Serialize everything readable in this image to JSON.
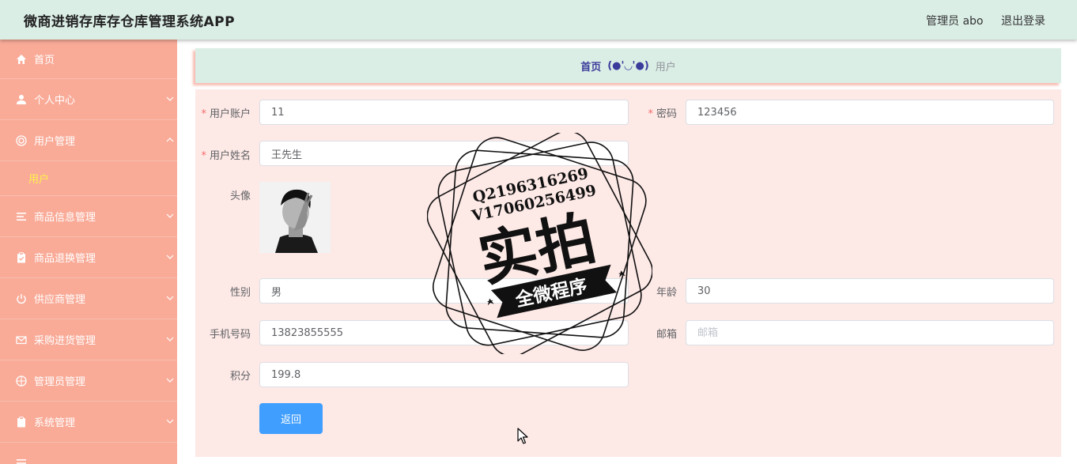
{
  "header": {
    "title": "微商进销存库存仓库管理系统APP",
    "user": "管理员 abo",
    "logout": "退出登录"
  },
  "sidebar": {
    "items": [
      {
        "label": "首页",
        "icon": "home-icon"
      },
      {
        "label": "个人中心",
        "icon": "user-icon"
      },
      {
        "label": "用户管理",
        "icon": "target-icon",
        "expanded": true,
        "children": [
          {
            "label": "用户"
          }
        ]
      },
      {
        "label": "商品信息管理",
        "icon": "list-icon"
      },
      {
        "label": "商品退换管理",
        "icon": "clipboard-icon"
      },
      {
        "label": "供应商管理",
        "icon": "power-icon"
      },
      {
        "label": "采购进货管理",
        "icon": "mail-icon"
      },
      {
        "label": "管理员管理",
        "icon": "compass-icon"
      },
      {
        "label": "系统管理",
        "icon": "clipboard-icon"
      }
    ],
    "active_color": "#fff24a"
  },
  "breadcrumb": {
    "home": "首页",
    "separator": "(●'◡'●)",
    "current": "用户"
  },
  "form": {
    "account": {
      "label": "用户账户",
      "value": "11"
    },
    "password": {
      "label": "密码",
      "value": "123456"
    },
    "name": {
      "label": "用户姓名",
      "value": "王先生"
    },
    "avatar": {
      "label": "头像"
    },
    "gender": {
      "label": "性别",
      "value": "男"
    },
    "age": {
      "label": "年龄",
      "value": "30"
    },
    "phone": {
      "label": "手机号码",
      "value": "13823855555"
    },
    "email": {
      "label": "邮箱",
      "value": "",
      "placeholder": "邮箱"
    },
    "points": {
      "label": "积分",
      "value": "199.8"
    },
    "back_label": "返回",
    "required_mark": "*"
  },
  "stamp": {
    "line1": "Q2196316269",
    "line2": "V17060256499",
    "big": "实拍",
    "ribbon": "全微程序"
  },
  "colors": {
    "header_bg": "#dbeee6",
    "sidebar_bg": "#f9ab98",
    "panel_bg": "#fde9e6",
    "primary": "#409eff"
  }
}
